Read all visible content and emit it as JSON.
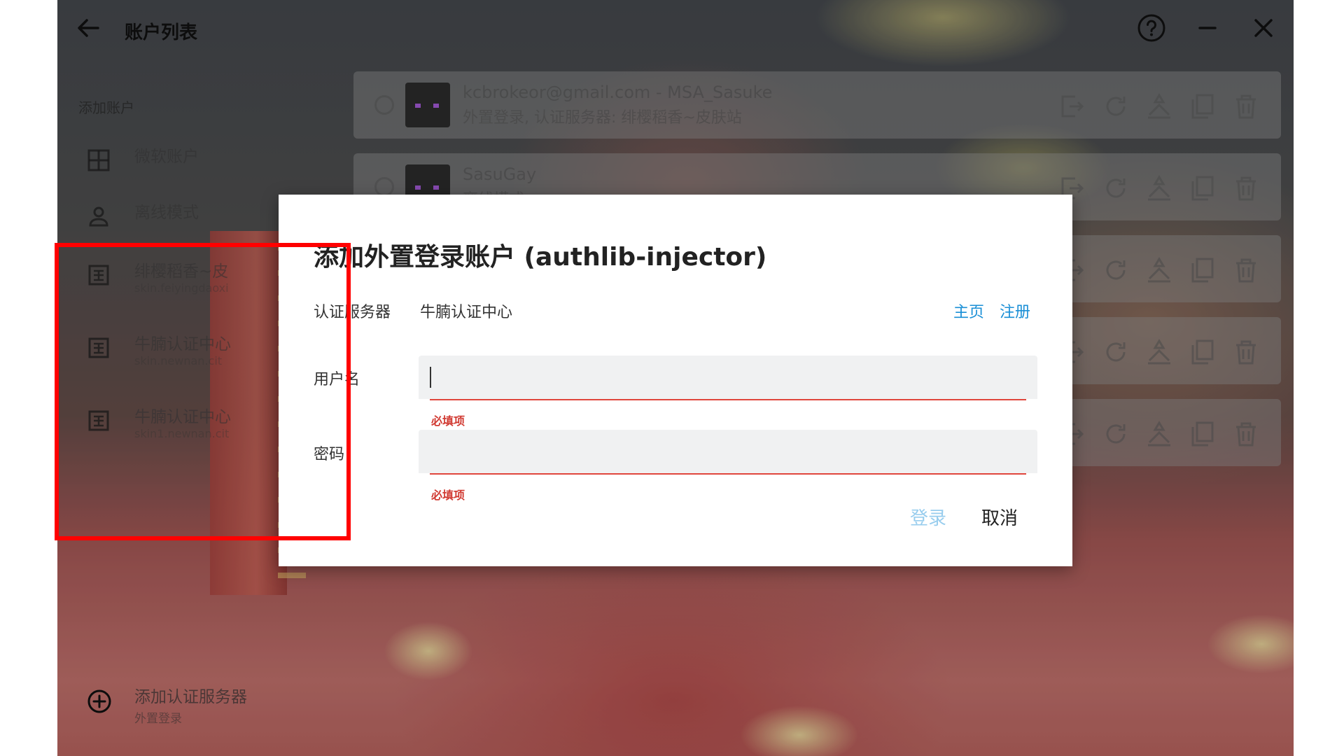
{
  "window": {
    "title": "账户列表"
  },
  "sidebar": {
    "header": "添加账户",
    "items": [
      {
        "label": "微软账户",
        "sub": "",
        "icon": "grid-icon"
      },
      {
        "label": "离线模式",
        "sub": "",
        "icon": "person-icon"
      },
      {
        "label": "绯樱稻香~皮",
        "sub": "skin.feiyingdaoxi",
        "icon": "server-icon"
      },
      {
        "label": "牛腩认证中心",
        "sub": "skin.newnan.cit",
        "icon": "server-icon"
      },
      {
        "label": "牛腩认证中心",
        "sub": "skin1.newnan.cit",
        "icon": "server-icon"
      }
    ],
    "add_server": {
      "label": "添加认证服务器",
      "sub": "外置登录"
    }
  },
  "accounts": [
    {
      "name": "kcbrokeor@gmail.com - MSA_Sasuke",
      "desc": "外置登录, 认证服务器: 绯樱稻香~皮肤站"
    },
    {
      "name": "SasuGay",
      "desc": "离线模式"
    },
    {
      "name": "",
      "desc": ""
    },
    {
      "name": "",
      "desc": ""
    },
    {
      "name": "",
      "desc": ""
    }
  ],
  "dialog": {
    "title": "添加外置登录账户 (authlib-injector)",
    "server_label": "认证服务器",
    "server_name": "牛腩认证中心",
    "home_link": "主页",
    "register_link": "注册",
    "username_label": "用户名",
    "username_value": "",
    "username_error": "必填项",
    "password_label": "密码",
    "password_value": "",
    "password_error": "必填项",
    "login_label": "登录",
    "cancel_label": "取消"
  },
  "colors": {
    "link": "#1a8fd6",
    "error": "#e0463c",
    "highlight": "#ff0000",
    "login_disabled": "#98cdee"
  }
}
